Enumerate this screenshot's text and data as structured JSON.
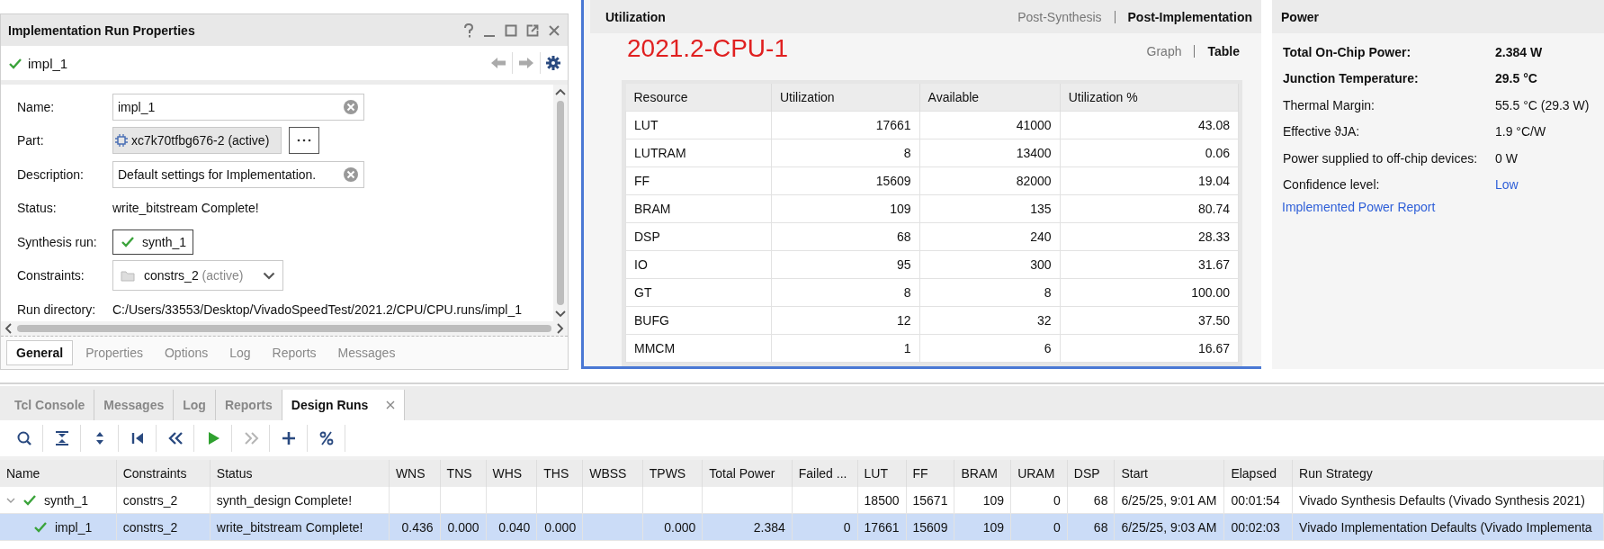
{
  "properties_panel": {
    "title": "Implementation Run Properties",
    "run": {
      "name": "impl_1",
      "complete": true
    },
    "fields": [
      {
        "kind": "text",
        "label": "Name:",
        "value": "impl_1"
      },
      {
        "kind": "part",
        "label": "Part:",
        "value": "xc7k70tfbg676-2 (active)"
      },
      {
        "kind": "text",
        "label": "Description:",
        "value": "Default settings for Implementation."
      },
      {
        "kind": "static",
        "label": "Status:",
        "value": "write_bitstream Complete!"
      },
      {
        "kind": "run",
        "label": "Synthesis run:",
        "value": "synth_1"
      },
      {
        "kind": "dropdown",
        "label": "Constraints:",
        "value": "constrs_2",
        "note": "(active)"
      },
      {
        "kind": "static",
        "label": "Run directory:",
        "value": "C:/Users/33553/Desktop/VivadoSpeedTest/2021.2/CPU/CPU.runs/impl_1"
      }
    ],
    "tabs": [
      {
        "label": "General",
        "selected": true
      },
      {
        "label": "Properties",
        "selected": false
      },
      {
        "label": "Options",
        "selected": false
      },
      {
        "label": "Log",
        "selected": false
      },
      {
        "label": "Reports",
        "selected": false
      },
      {
        "label": "Messages",
        "selected": false
      }
    ]
  },
  "utilization": {
    "title": "Utilization",
    "modes": [
      {
        "label": "Post-Synthesis",
        "selected": false
      },
      {
        "label": "Post-Implementation",
        "selected": true
      }
    ],
    "annotation": "2021.2-CPU-1",
    "views": [
      {
        "label": "Graph",
        "selected": false
      },
      {
        "label": "Table",
        "selected": true
      }
    ],
    "table": {
      "columns": [
        "Resource",
        "Utilization",
        "Available",
        "Utilization %"
      ],
      "rows": [
        [
          "LUT",
          "17661",
          "41000",
          "43.08"
        ],
        [
          "LUTRAM",
          "8",
          "13400",
          "0.06"
        ],
        [
          "FF",
          "15609",
          "82000",
          "19.04"
        ],
        [
          "BRAM",
          "109",
          "135",
          "80.74"
        ],
        [
          "DSP",
          "68",
          "240",
          "28.33"
        ],
        [
          "IO",
          "95",
          "300",
          "31.67"
        ],
        [
          "GT",
          "8",
          "8",
          "100.00"
        ],
        [
          "BUFG",
          "12",
          "32",
          "37.50"
        ],
        [
          "MMCM",
          "1",
          "6",
          "16.67"
        ]
      ]
    }
  },
  "power": {
    "title": "Power",
    "rows": [
      {
        "kind": "emphasis",
        "label": "Total On-Chip Power:",
        "value": "2.384 W"
      },
      {
        "kind": "emphasis",
        "label": "Junction Temperature:",
        "value": "29.5 °C"
      },
      {
        "kind": "plain",
        "label": "Thermal Margin:",
        "value": "55.5 °C (29.3 W)"
      },
      {
        "kind": "plain",
        "label": "Effective ϑJA:",
        "value": "1.9 °C/W"
      },
      {
        "kind": "plain",
        "label": "Power supplied to off-chip devices:",
        "value": "0 W"
      },
      {
        "kind": "link",
        "label": "Confidence level:",
        "value": "Low"
      }
    ],
    "link": "Implemented Power Report"
  },
  "design_runs": {
    "tabs": [
      {
        "label": "Tcl Console",
        "selected": false
      },
      {
        "label": "Messages",
        "selected": false
      },
      {
        "label": "Log",
        "selected": false
      },
      {
        "label": "Reports",
        "selected": false
      },
      {
        "label": "Design Runs",
        "selected": true
      }
    ],
    "toolbar": [
      {
        "kind": "search",
        "disabled": false
      },
      {
        "kind": "collapse",
        "disabled": false
      },
      {
        "kind": "expand",
        "disabled": false
      },
      {
        "kind": "first",
        "disabled": false
      },
      {
        "kind": "previous",
        "disabled": false
      },
      {
        "kind": "run",
        "disabled": false
      },
      {
        "kind": "next",
        "disabled": true
      },
      {
        "kind": "add",
        "disabled": false
      },
      {
        "kind": "percent",
        "disabled": false
      }
    ],
    "columns": [
      "Name",
      "Constraints",
      "Status",
      "WNS",
      "TNS",
      "WHS",
      "THS",
      "WBSS",
      "TPWS",
      "Total Power",
      "Failed ...",
      "LUT",
      "FF",
      "BRAM",
      "URAM",
      "DSP",
      "Start",
      "Elapsed",
      "Run Strategy"
    ],
    "rows": [
      {
        "complete": true,
        "selected": false,
        "expanded": true,
        "cells": [
          "synth_1",
          "constrs_2",
          "synth_design Complete!",
          "",
          "",
          "",
          "",
          "",
          "",
          "",
          "",
          "18500",
          "15671",
          "109",
          "0",
          "68",
          "6/25/25, 9:01 AM",
          "00:01:54",
          "Vivado Synthesis Defaults (Vivado Synthesis 2021)"
        ],
        "children": [
          {
            "complete": true,
            "selected": true,
            "cells": [
              "impl_1",
              "constrs_2",
              "write_bitstream Complete!",
              "0.436",
              "0.000",
              "0.040",
              "0.000",
              "",
              "0.000",
              "2.384",
              "0",
              "17661",
              "15609",
              "109",
              "0",
              "68",
              "6/25/25, 9:03 AM",
              "00:02:03",
              "Vivado Implementation Defaults (Vivado Implementa"
            ]
          }
        ]
      }
    ]
  }
}
